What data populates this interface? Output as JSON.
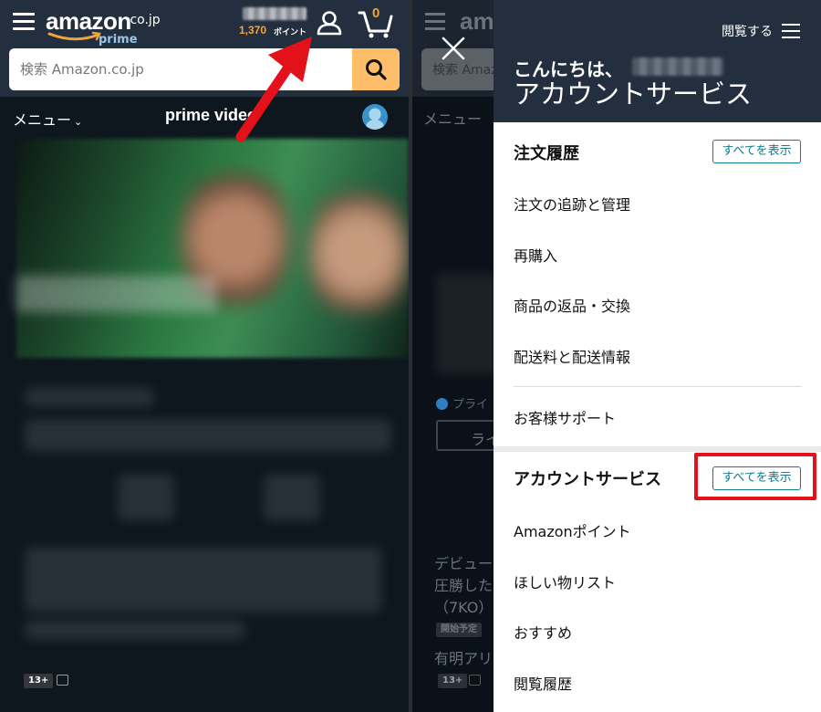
{
  "left": {
    "logo": {
      "word": "amazon",
      "tld": ".co.jp",
      "prime": "prime"
    },
    "points": {
      "value": "1,370",
      "label": "ポイント"
    },
    "cart": {
      "count": "0"
    },
    "search": {
      "placeholder": "検索 Amazon.co.jp"
    },
    "subnav": {
      "menu": "メニュー",
      "brand": "prime video"
    },
    "rating_badge": "13+"
  },
  "underlay": {
    "logo_partial": "amaz",
    "search_partial": "検索 Amaz",
    "menu_partial": "メニュー ",
    "prime_partial": "プライ",
    "button_partial": "ライ",
    "desc_lines": [
      "デビュー",
      "圧勝した",
      "（7KO）"
    ],
    "tag_partial": "開始予定",
    "venue_partial": "有明アリ",
    "rating_badge": "13+"
  },
  "drawer": {
    "browse_label": "閲覧する",
    "greeting": "こんにちは、",
    "title": "アカウントサービス",
    "orders": {
      "title": "注文履歴",
      "show_all": "すべてを表示",
      "items": [
        "注文の追跡と管理",
        "再購入",
        "商品の返品・交換",
        "配送料と配送情報"
      ],
      "support": "お客様サポート"
    },
    "account": {
      "title": "アカウントサービス",
      "show_all": "すべてを表示",
      "items": [
        "Amazonポイント",
        "ほしい物リスト",
        "おすすめ",
        "閲覧履歴"
      ]
    }
  },
  "colors": {
    "header": "#232f3e",
    "accent_orange": "#febd69",
    "points_orange": "#f0a43a",
    "link_teal": "#0a7e8c",
    "annotation_red": "#e3121a"
  }
}
